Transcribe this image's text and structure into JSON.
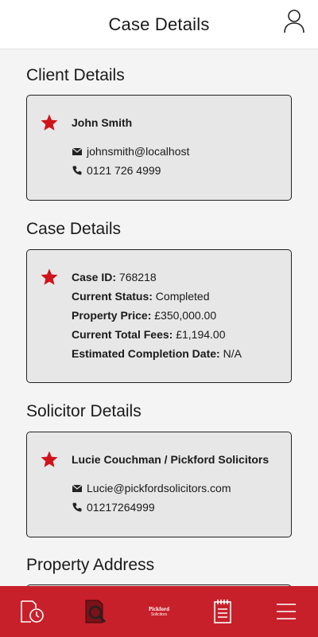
{
  "header": {
    "title": "Case Details"
  },
  "client": {
    "section_title": "Client Details",
    "name": "John Smith",
    "email": "johnsmith@localhost",
    "phone": "0121 726 4999"
  },
  "case": {
    "section_title": "Case Details",
    "rows": [
      {
        "label": "Case ID:",
        "value": "768218"
      },
      {
        "label": "Current Status:",
        "value": "Completed"
      },
      {
        "label": "Property Price:",
        "value": "£350,000.00"
      },
      {
        "label": "Current Total Fees:",
        "value": "£1,194.00"
      },
      {
        "label": "Estimated Completion Date:",
        "value": "N/A"
      }
    ]
  },
  "solicitor": {
    "section_title": "Solicitor Details",
    "name": "Lucie Couchman / Pickford Solicitors",
    "email": "Lucie@pickfordsolicitors.com",
    "phone": "01217264999"
  },
  "property": {
    "section_title": "Property Address"
  },
  "tabbar": {
    "logo_top": "Pickford",
    "logo_bottom": "Solicitors",
    "tabs": [
      "timeline-icon",
      "search-document-icon",
      "pickford-logo",
      "notepad-icon",
      "menu-icon"
    ]
  },
  "colors": {
    "accent": "#c8202a",
    "star": "#d0121b",
    "card": "#e7e7e7"
  }
}
